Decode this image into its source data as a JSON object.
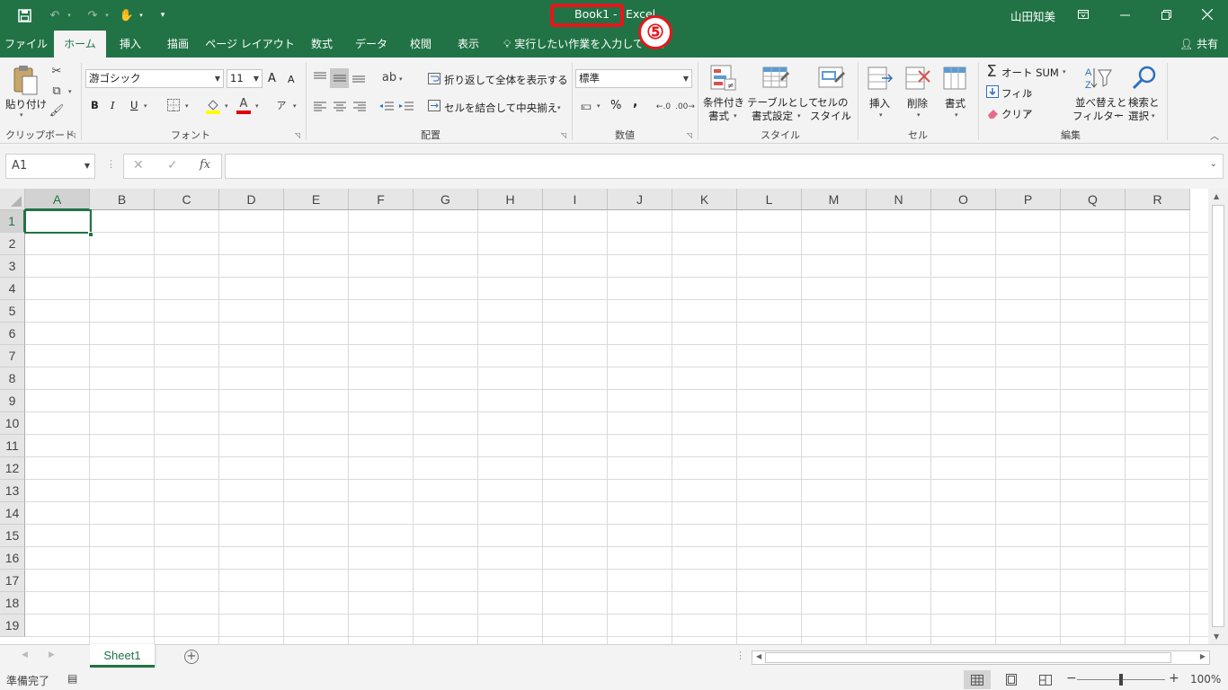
{
  "title_bar": {
    "doc_name": "Book1",
    "separator": "-",
    "app_name": "Excel",
    "step_badge": "⑤",
    "user_name": "山田知美",
    "save_icon": "save-icon",
    "undo_icon": "undo-icon",
    "redo_icon": "redo-icon",
    "touch_icon": "touch-mode-icon",
    "customize_icon": "customize-qat-icon"
  },
  "tabs": [
    "ファイル",
    "ホーム",
    "挿入",
    "描画",
    "ページ レイアウト",
    "数式",
    "データ",
    "校閲",
    "表示"
  ],
  "tell_me": "実行したい作業を入力してくだ",
  "share": "共有",
  "ribbon": {
    "clipboard": {
      "paste": "貼り付け",
      "label": "クリップボード"
    },
    "font": {
      "name": "游ゴシック",
      "size": "11",
      "bold": "B",
      "italic": "I",
      "underline": "U",
      "grow": "A",
      "shrink": "A",
      "color": "A",
      "label": "フォント"
    },
    "alignment": {
      "wrap": "折り返して全体を表示する",
      "merge": "セルを結合して中央揃え",
      "label": "配置"
    },
    "number": {
      "format": "標準",
      "percent": "%",
      "comma": ",",
      "label": "数値"
    },
    "styles": {
      "conditional_1": "条件付き",
      "conditional_2": "書式",
      "table_1": "テーブルとして",
      "table_2": "書式設定",
      "cell_1": "セルの",
      "cell_2": "スタイル",
      "label": "スタイル"
    },
    "cells": {
      "insert": "挿入",
      "delete": "削除",
      "format": "書式",
      "label": "セル"
    },
    "editing": {
      "autosum": "オート SUM",
      "fill": "フィル",
      "clear": "クリア",
      "sort_1": "並べ替えと",
      "sort_2": "フィルター",
      "find_1": "検索と",
      "find_2": "選択",
      "label": "編集"
    }
  },
  "formula_bar": {
    "name_box": "A1",
    "cancel": "✕",
    "enter": "✓",
    "fx": "fx",
    "value": ""
  },
  "columns": [
    "A",
    "B",
    "C",
    "D",
    "E",
    "F",
    "G",
    "H",
    "I",
    "J",
    "K",
    "L",
    "M",
    "N",
    "O",
    "P",
    "Q",
    "R"
  ],
  "rows": [
    "1",
    "2",
    "3",
    "4",
    "5",
    "6",
    "7",
    "8",
    "9",
    "10",
    "11",
    "12",
    "13",
    "14",
    "15",
    "16",
    "17",
    "18",
    "19"
  ],
  "sheet_tab": "Sheet1",
  "status": {
    "ready": "準備完了",
    "zoom": "100%"
  },
  "colors": {
    "excel_green": "#217346",
    "highlight_red": "#e8151b"
  }
}
